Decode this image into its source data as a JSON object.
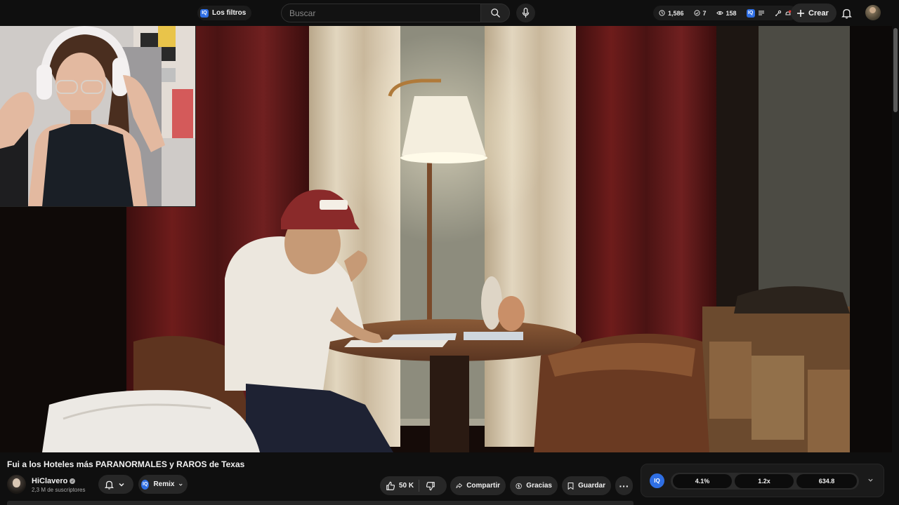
{
  "header": {
    "filters_badge": "IQ",
    "filters_label": "Los filtros",
    "search_placeholder": "Buscar",
    "stats": {
      "time_value": "1,586",
      "check_value": "7",
      "views_value": "158",
      "iq_badge": "IQ"
    },
    "create_label": "Crear"
  },
  "video": {
    "title": "Fui a los Hoteles más PARANORMALES y RAROS de Texas",
    "channel": {
      "name": "HiClavero",
      "verified_mark": "✓",
      "subscribers": "2,3 M de suscriptores"
    }
  },
  "actions": {
    "remix_badge": "IQ",
    "remix_label": "Remix",
    "like_count": "50 K",
    "share_label": "Compartir",
    "thanks_label": "Gracias",
    "save_label": "Guardar",
    "more_label": "···"
  },
  "iq_panel": {
    "badge": "IQ",
    "metrics": [
      "4.1%",
      "1.2x",
      "634.8"
    ]
  },
  "colors": {
    "background": "#0f0f0f",
    "pill": "#272727",
    "iq_accent": "#2f6fe4"
  },
  "icons": [
    "iq-badge",
    "search-icon",
    "mic-icon",
    "clock-icon",
    "check-icon",
    "eye-icon",
    "list-icon",
    "cast-icon",
    "notification-dot-icon",
    "plus-icon",
    "bell-icon",
    "verified-icon",
    "chevron-down-icon",
    "like-icon",
    "dislike-icon",
    "share-icon",
    "thanks-icon",
    "save-icon",
    "more-icon"
  ]
}
